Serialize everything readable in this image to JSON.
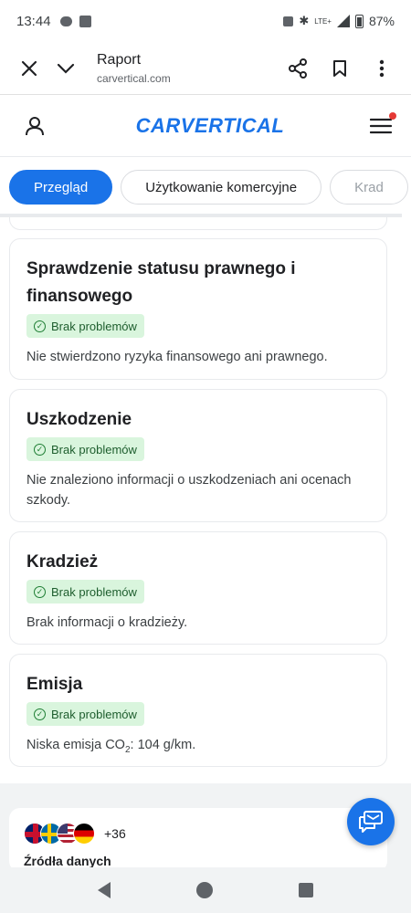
{
  "status_bar": {
    "time": "13:44",
    "lte": "LTE+",
    "battery": "87%"
  },
  "browser": {
    "title": "Raport",
    "domain": "carvertical.com"
  },
  "site": {
    "logo": "CARVERTICAL"
  },
  "tabs": [
    {
      "label": "Przegląd",
      "active": true
    },
    {
      "label": "Użytkowanie komercyjne",
      "active": false
    },
    {
      "label": "Krad",
      "active": false
    }
  ],
  "cards": [
    {
      "title_line1": "Sprawdzenie statusu prawnego i",
      "title_line2": "finansowego",
      "badge": "Brak problemów",
      "desc": "Nie stwierdzono ryzyka finansowego ani prawnego."
    },
    {
      "title": "Uszkodzenie",
      "badge": "Brak problemów",
      "desc": "Nie znaleziono informacji o uszkodzeniach ani ocenach szkody."
    },
    {
      "title": "Kradzież",
      "badge": "Brak problemów",
      "desc": "Brak informacji o kradzieży."
    },
    {
      "title": "Emisja",
      "badge": "Brak problemów",
      "desc_prefix": "Niska emisja CO",
      "desc_sub": "2",
      "desc_suffix": ": 104 g/km."
    }
  ],
  "sources": {
    "more_count": "+36",
    "title": "Źródła danych"
  },
  "colors": {
    "accent": "#1a73e8",
    "badge_bg": "#d9f5dd",
    "badge_text": "#1e5e2e",
    "notify_dot": "#e53935"
  }
}
